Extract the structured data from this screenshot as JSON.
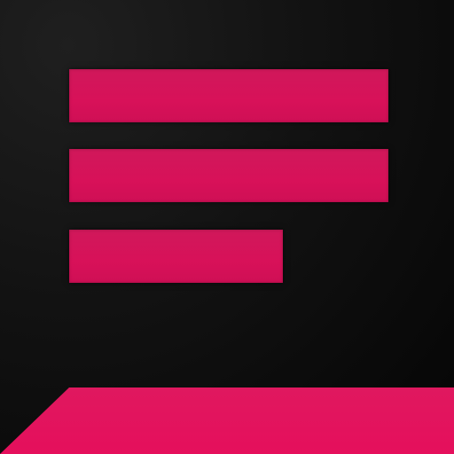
{
  "icon": {
    "name": "text-lines-app-icon",
    "accent_color": "#d81159",
    "background_color": "#0a0a0a"
  }
}
